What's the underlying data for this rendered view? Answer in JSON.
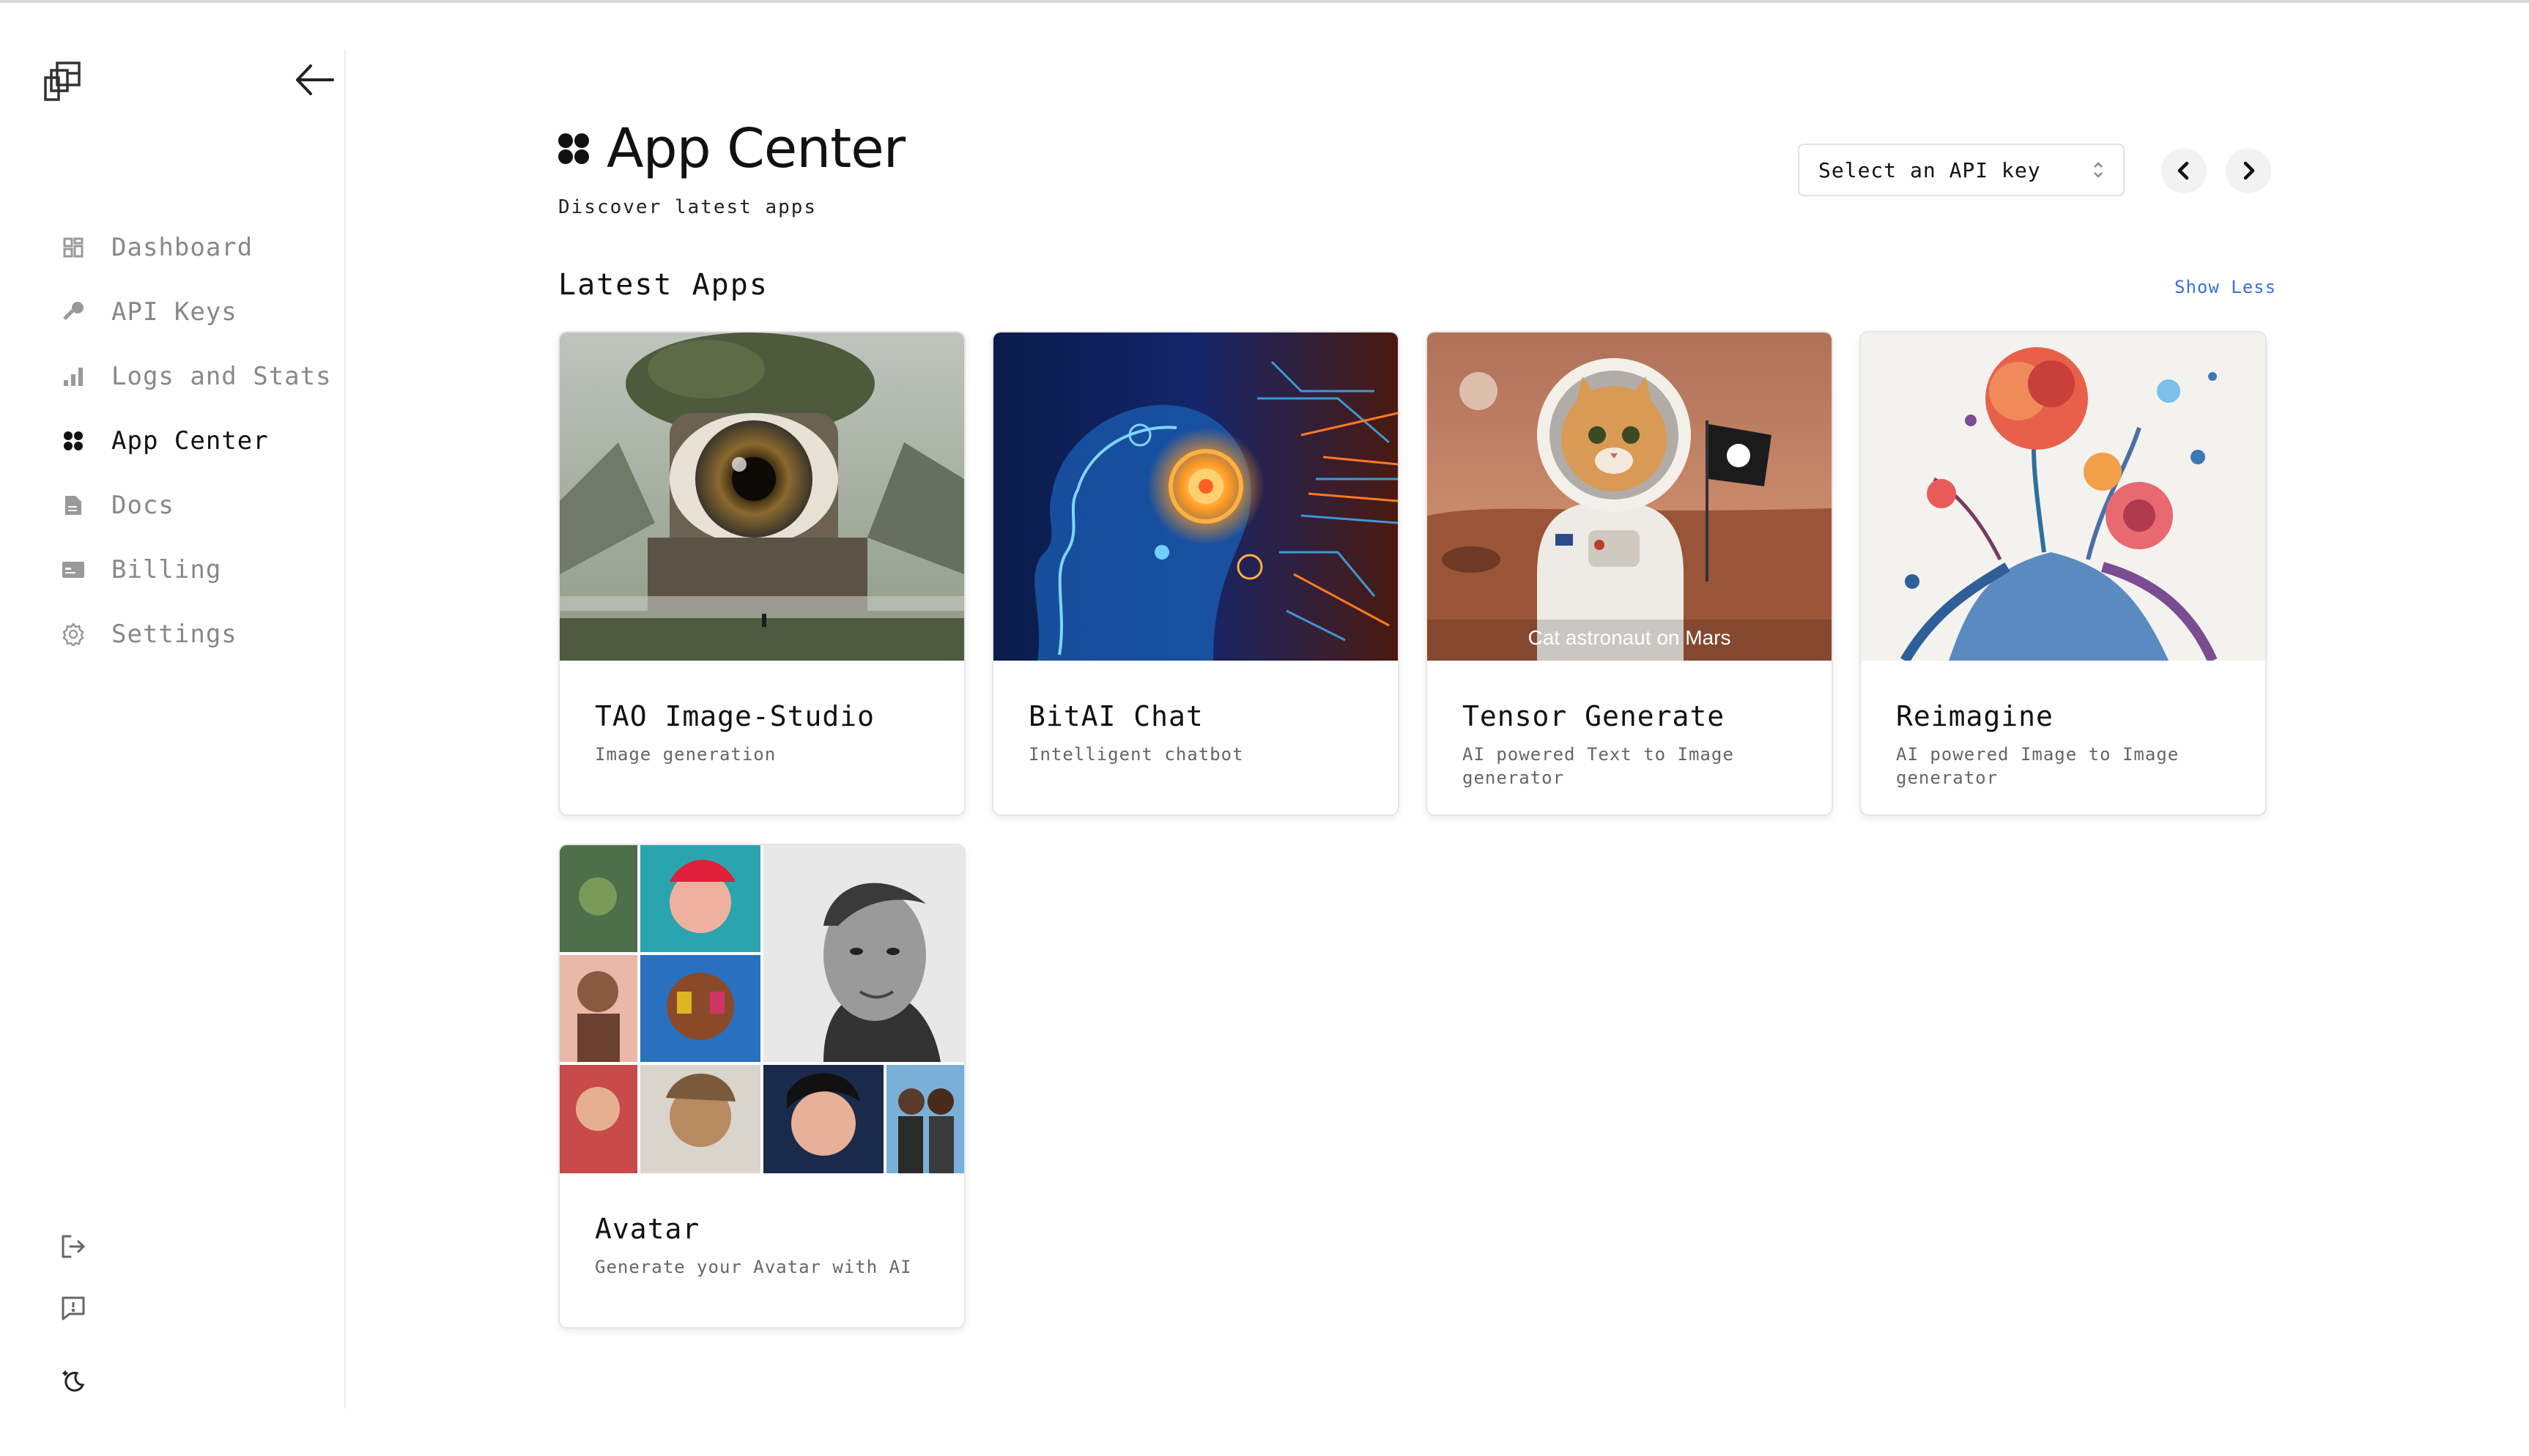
{
  "sidebar": {
    "logo_icon": "logo-icon",
    "collapse_icon": "arrow-left-icon",
    "items": [
      {
        "label": "Dashboard",
        "icon": "dashboard-icon",
        "active": false
      },
      {
        "label": "API Keys",
        "icon": "key-icon",
        "active": false
      },
      {
        "label": "Logs and Stats",
        "icon": "bar-chart-icon",
        "active": false
      },
      {
        "label": "App Center",
        "icon": "apps-icon",
        "active": true
      },
      {
        "label": "Docs",
        "icon": "document-icon",
        "active": false
      },
      {
        "label": "Billing",
        "icon": "credit-card-icon",
        "active": false
      },
      {
        "label": "Settings",
        "icon": "gear-icon",
        "active": false
      }
    ],
    "bottom_icons": [
      "logout-icon",
      "feedback-icon",
      "theme-toggle-icon"
    ]
  },
  "header": {
    "title": "App Center",
    "subtitle": "Discover latest apps",
    "api_key_select": {
      "value": "Select an API key"
    },
    "prev_icon": "chevron-left-icon",
    "next_icon": "chevron-right-icon"
  },
  "latest": {
    "title": "Latest Apps",
    "toggle_label": "Show Less",
    "apps": [
      {
        "name": "TAO Image-Studio",
        "description": "Image generation"
      },
      {
        "name": "BitAI Chat",
        "description": "Intelligent chatbot"
      },
      {
        "name": "Tensor Generate",
        "description": "AI powered Text to Image generator",
        "image_caption": "Cat astronaut on Mars"
      },
      {
        "name": "Reimagine",
        "description": "AI powered Image to Image generator"
      },
      {
        "name": "Avatar",
        "description": "Generate your Avatar with AI"
      }
    ]
  },
  "colors": {
    "accent_link": "#3b6fd8",
    "active_text": "#111111",
    "muted_text": "#888888"
  }
}
